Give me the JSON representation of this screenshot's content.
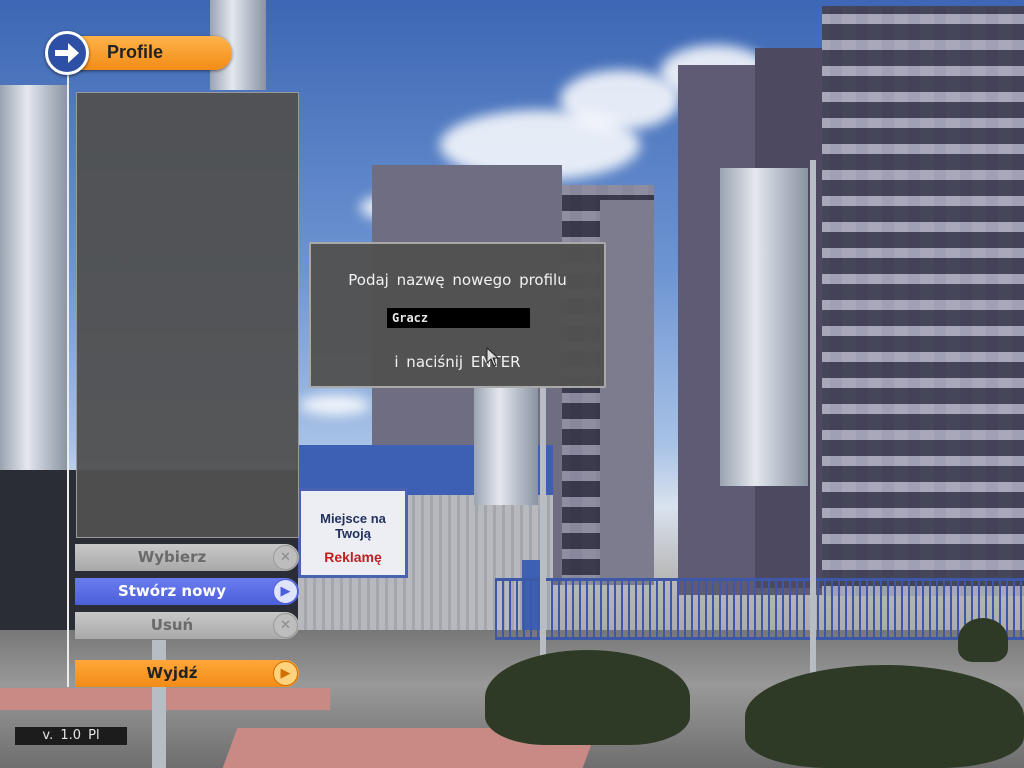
{
  "header": {
    "title": "Profile",
    "icon": "arrow-right-icon"
  },
  "profile_list": {
    "items": []
  },
  "menu": {
    "select": {
      "label": "Wybierz",
      "icon": "close-icon",
      "state": "disabled"
    },
    "create": {
      "label": "Stwórz nowy",
      "icon": "arrow-right-icon",
      "state": "active"
    },
    "delete": {
      "label": "Usuń",
      "icon": "close-icon",
      "state": "disabled"
    },
    "exit": {
      "label": "Wyjdź",
      "icon": "arrow-right-icon",
      "state": "enabled"
    }
  },
  "dialog": {
    "prompt": "Podaj nazwę nowego profilu",
    "name_value": "Gracz",
    "hint": "i naciśnij ENTER"
  },
  "billboard": {
    "line1": "Miejsce na Twoją",
    "line2": "Reklamę"
  },
  "footer": {
    "version": "v. 1.0 Pl"
  },
  "colors": {
    "accent_orange": "#f28c17",
    "active_blue": "#4b5fd8",
    "panel_grey": "#505050"
  }
}
